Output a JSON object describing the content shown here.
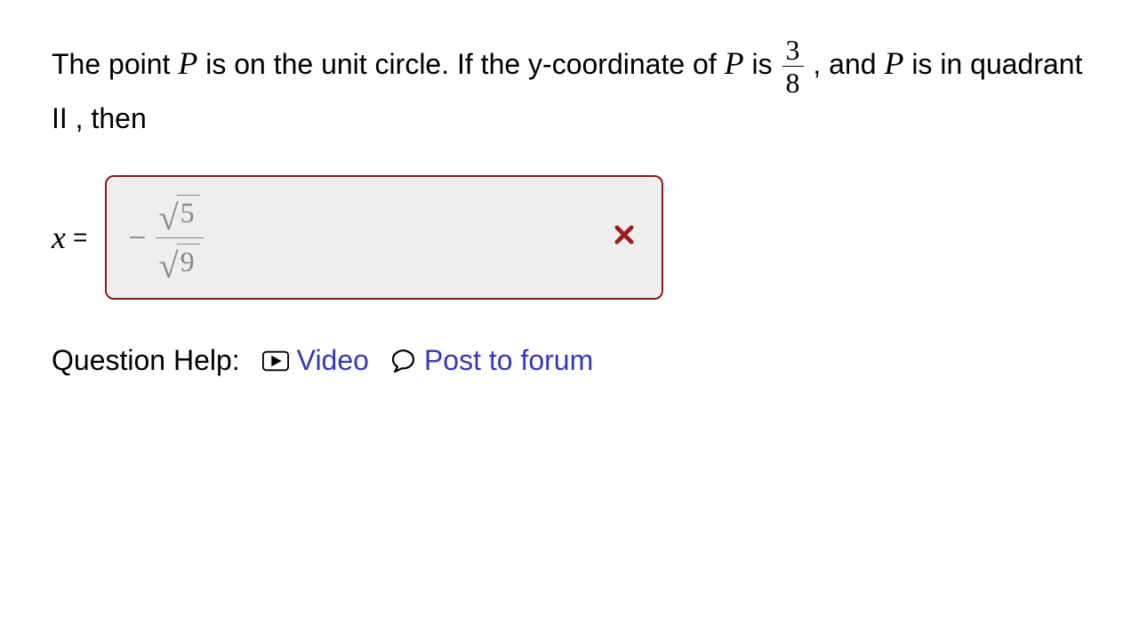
{
  "question": {
    "prefix": "The point ",
    "P1": "P",
    "mid1": " is on the unit circle. If the y-coordinate of ",
    "P2": "P",
    "mid2": " is ",
    "fraction": {
      "num": "3",
      "den": "8"
    },
    "mid3": ", and ",
    "P3": "P",
    "suffix": " is in quadrant II , then"
  },
  "answer": {
    "var": "x",
    "equals": "=",
    "minus": "−",
    "sqrt_num": "5",
    "sqrt_den": "9",
    "correct": false
  },
  "help": {
    "label": "Question Help:",
    "video_label": "Video",
    "forum_label": "Post to forum"
  }
}
